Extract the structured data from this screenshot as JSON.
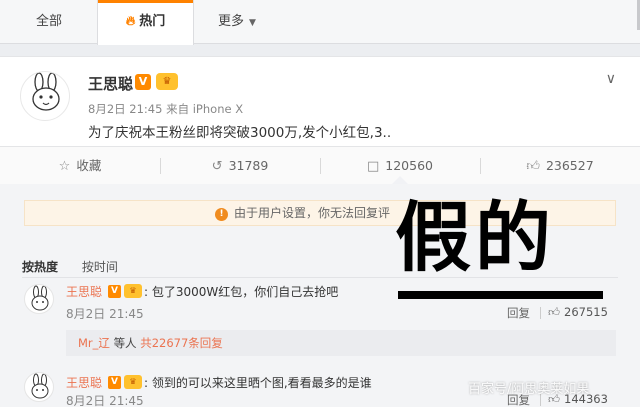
{
  "tabs": {
    "all": "全部",
    "hot": "热门",
    "more": "更多"
  },
  "post": {
    "username": "王思聪",
    "meta": "8月2日 21:45 来自 iPhone X",
    "text": "为了庆祝本王粉丝即将突破3000万,发个小红包,3..",
    "avatar_caption": "宝宝不聊"
  },
  "actions": {
    "favorite": "收藏",
    "repost": "31789",
    "comment": "120560",
    "like": "236527"
  },
  "notice": "由于用户设置，你无法回复评",
  "sort": {
    "hot": "按热度",
    "time": "按时间"
  },
  "comments": [
    {
      "name": "王思聪",
      "text": ": 包了3000W红包，你们自己去抢吧",
      "time": "8月2日 21:45",
      "reply": "回复",
      "likes": "267515"
    },
    {
      "name": "王思聪",
      "text": ": 领到的可以来这里晒个图,看看最多的是谁",
      "time": "8月2日 21:45",
      "reply": "回复",
      "likes": "144363"
    }
  ],
  "sub_reply": {
    "user": "Mr_辽",
    "mid": "等人",
    "count": "共22677条回复"
  },
  "overlay": {
    "big_text": "假的",
    "watermark": "百家号/阿思奥莱如果"
  },
  "colors": {
    "accent": "#ff8200",
    "name": "#eb7350",
    "verified": "#ff8a00"
  }
}
